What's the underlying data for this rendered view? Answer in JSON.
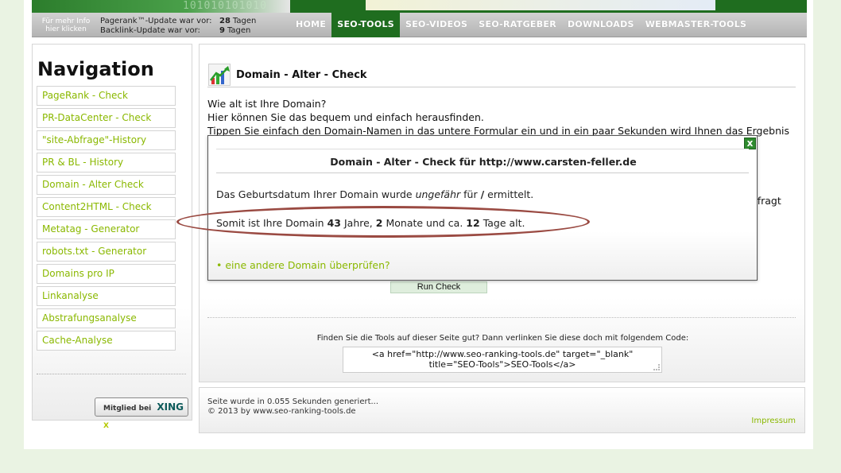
{
  "header": {
    "banner_binary": "101010101010",
    "more_info": "Für mehr Info hier klicken",
    "pagerank_label": "Pagerank™-Update war vor:",
    "pagerank_days": "28",
    "backlink_label": "Backlink-Update war vor:",
    "backlink_days": "9",
    "days_unit": "Tagen",
    "menu": [
      "HOME",
      "SEO-TOOLS",
      "SEO-VIDEOS",
      "SEO-RATGEBER",
      "DOWNLOADS",
      "WEBMASTER-TOOLS"
    ],
    "active_menu": "SEO-TOOLS"
  },
  "sidebar": {
    "title": "Navigation",
    "items": [
      "PageRank - Check",
      "PR-DataCenter - Check",
      "\"site-Abfrage\"-History",
      "PR & BL - History",
      "Domain - Alter Check",
      "Content2HTML - Check",
      "Metatag - Generator",
      "robots.txt - Generator",
      "Domains pro IP",
      "Linkanalyse",
      "Abstrafungsanalyse",
      "Cache-Analyse"
    ],
    "xing_prefix": "Mitglied bei",
    "xing_word": "XING",
    "xing_mark": "X"
  },
  "main": {
    "title": "Domain - Alter - Check",
    "intro_lines": [
      "Wie alt ist Ihre Domain?",
      "Hier können Sie das bequem und einfach herausfinden.",
      "Tippen Sie einfach den Domain-Namen in das untere Formular ein und in ein paar Sekunden wird Ihnen das Ergebnis"
    ],
    "cut_word": "efragt",
    "run_button": "Run Check",
    "link_promo": "Finden Sie die Tools auf dieser Seite gut? Dann verlinken Sie diese doch mit folgendem Code:",
    "code_line1": "<a href=\"http://www.seo-ranking-tools.de\" target=\"_blank\"",
    "code_line2": "title=\"SEO-Tools\">SEO-Tools</a>"
  },
  "modal": {
    "close": "x",
    "title": "Domain - Alter - Check für http://www.carsten-feller.de",
    "p1_a": "Das Geburtsdatum Ihrer Domain wurde",
    "p1_em": "ungefähr",
    "p1_b": "für",
    "p1_strong": "/",
    "p1_c": "ermittelt.",
    "p2_a": "Somit ist Ihre Domain",
    "years": "43",
    "years_label": "Jahre,",
    "months": "2",
    "months_label": "Monate und ca.",
    "days": "12",
    "days_label": "Tage alt.",
    "bullet": "•",
    "link": "eine andere Domain überprüfen?"
  },
  "footer": {
    "generated": "Seite wurde in 0.055 Sekunden generiert...",
    "copyright": "© 2013 by www.seo-ranking-tools.de",
    "impressum": "Impressum"
  },
  "colors": {
    "brand_green": "#1f6d1f",
    "link_green": "#8ab800",
    "highlight": "#9a4a42"
  }
}
